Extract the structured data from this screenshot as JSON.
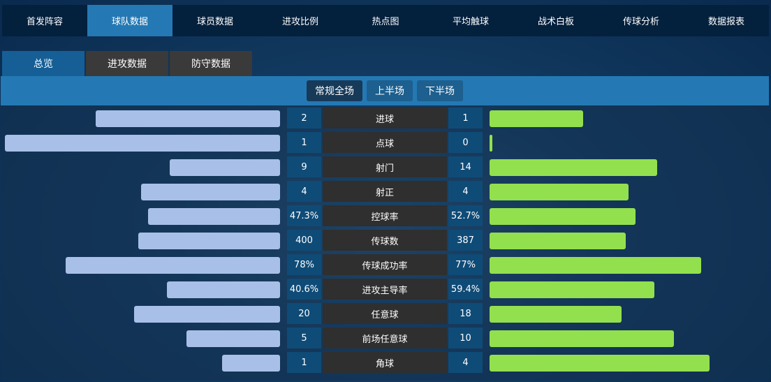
{
  "nav": [
    "首发阵容",
    "球队数据",
    "球员数据",
    "进攻比例",
    "热点图",
    "平均触球",
    "战术白板",
    "传球分析",
    "数据报表"
  ],
  "nav_active": 1,
  "subtabs": [
    "总览",
    "进攻数据",
    "防守数据"
  ],
  "periods": [
    "常规全场",
    "上半场",
    "下半场"
  ],
  "colors": {
    "home": "#a8c0e8",
    "away": "#92e04e",
    "active": "#2479b4"
  },
  "stats": [
    {
      "label": "进球",
      "home": "2",
      "away": "1",
      "home_fill": 0.67,
      "away_fill": 0.34
    },
    {
      "label": "点球",
      "home": "1",
      "away": "0",
      "home_fill": 1.0,
      "away_fill": 0.01
    },
    {
      "label": "射门",
      "home": "9",
      "away": "14",
      "home_fill": 0.4,
      "away_fill": 0.61
    },
    {
      "label": "射正",
      "home": "4",
      "away": "4",
      "home_fill": 0.505,
      "away_fill": 0.505
    },
    {
      "label": "控球率",
      "home": "47.3%",
      "away": "52.7%",
      "home_fill": 0.48,
      "away_fill": 0.53
    },
    {
      "label": "传球数",
      "home": "400",
      "away": "387",
      "home_fill": 0.515,
      "away_fill": 0.495
    },
    {
      "label": "传球成功率",
      "home": "78%",
      "away": "77%",
      "home_fill": 0.78,
      "away_fill": 0.77
    },
    {
      "label": "进攻主导率",
      "home": "40.6%",
      "away": "59.4%",
      "home_fill": 0.41,
      "away_fill": 0.6
    },
    {
      "label": "任意球",
      "home": "20",
      "away": "18",
      "home_fill": 0.53,
      "away_fill": 0.48
    },
    {
      "label": "前场任意球",
      "home": "5",
      "away": "10",
      "home_fill": 0.34,
      "away_fill": 0.67
    },
    {
      "label": "角球",
      "home": "1",
      "away": "4",
      "home_fill": 0.21,
      "away_fill": 0.8
    }
  ]
}
